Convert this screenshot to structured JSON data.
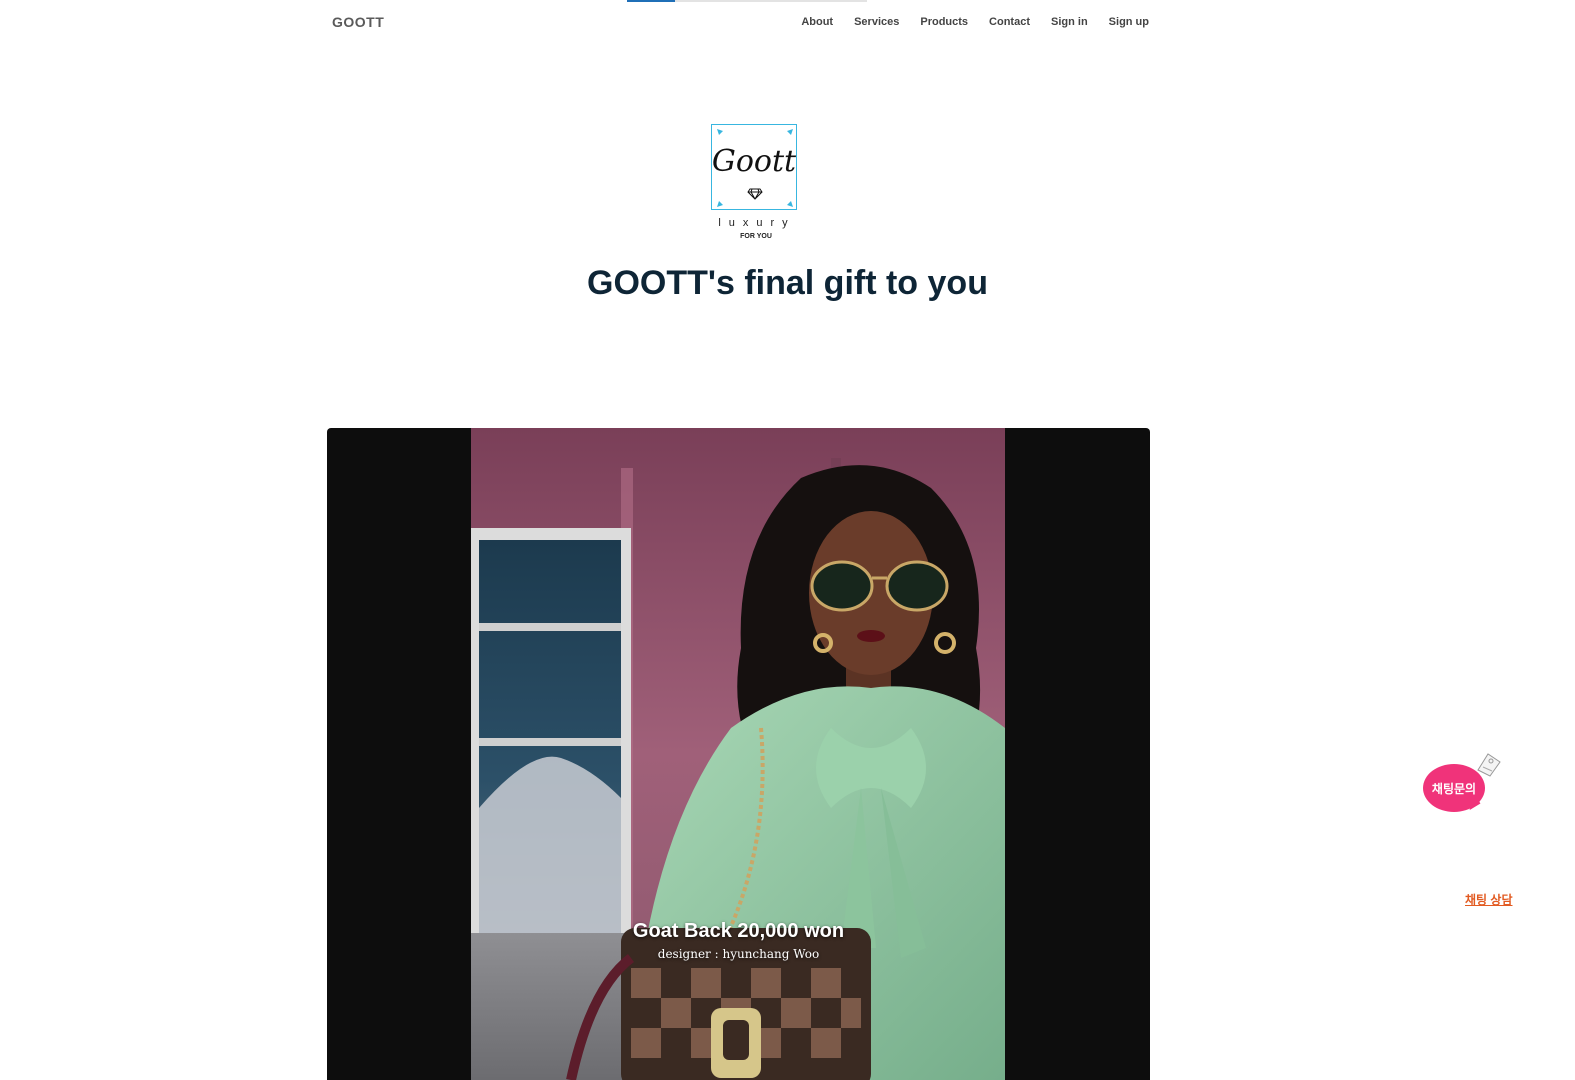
{
  "progress": {
    "fraction": 0.2
  },
  "header": {
    "brand": "GOOTT",
    "nav": [
      "About",
      "Services",
      "Products",
      "Contact",
      "Sign in",
      "Sign up"
    ]
  },
  "logo": {
    "script": "Goott",
    "word": "luxury",
    "tagline": "FOR YOU",
    "border_color": "#38b6e0"
  },
  "hero_headline": "GOOTT's final gift to you",
  "featured": {
    "title": "Goat Back 20,000 won",
    "subtitle": "designer : hyunchang Woo"
  },
  "chat": {
    "bubble_label": "채팅문의",
    "link_label": "채팅 상담",
    "bubble_color": "#f0337a",
    "link_color": "#e25b22"
  }
}
